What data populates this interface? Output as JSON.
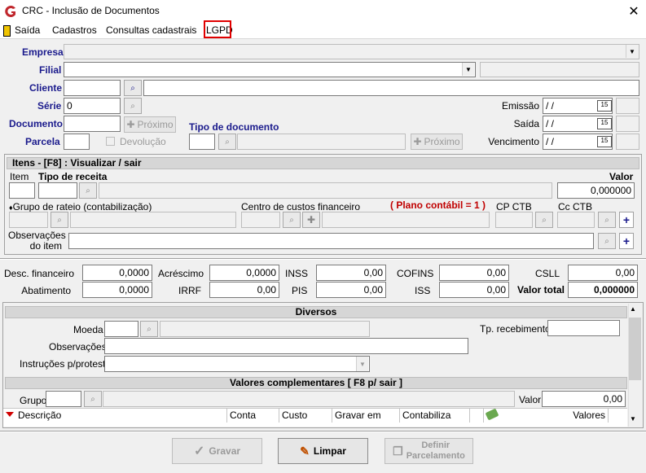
{
  "window": {
    "title": "CRC - Inclusão de Documentos",
    "close": "✕"
  },
  "menu": {
    "saida": "Saída",
    "cadastros": "Cadastros",
    "consultas": "Consultas cadastrais",
    "lgpd": "LGPD"
  },
  "header": {
    "empresa": "Empresa",
    "filial": "Filial",
    "cliente": "Cliente",
    "serie": "Série",
    "serie_value": "0",
    "documento": "Documento",
    "parcela": "Parcela",
    "proximo": "Próximo",
    "devolucao": "Devolução",
    "tipo_documento": "Tipo de documento",
    "proximo2": "Próximo",
    "emissao": "Emissão",
    "saida": "Saída",
    "vencimento": "Vencimento",
    "date_placeholder": " /  /",
    "cal": "15"
  },
  "itens": {
    "title": "Itens   - [F8] : Visualizar / sair",
    "item": "Item",
    "tipo_receita": "Tipo de receita",
    "valor": "Valor",
    "valor_value": "0,000000",
    "grupo_rateio": "Grupo de rateio (contabilização)",
    "centro_custos": "Centro de custos financeiro",
    "plano": "( Plano contábil = 1 )",
    "cp_ctb": "CP CTB",
    "cc_ctb": "Cc CTB",
    "obs_line1": "Observações",
    "obs_line2": "do item"
  },
  "totais": {
    "desc_fin": "Desc. financeiro",
    "desc_fin_v": "0,0000",
    "acrescimo": "Acréscimo",
    "acrescimo_v": "0,0000",
    "inss": "INSS",
    "inss_v": "0,00",
    "cofins": "COFINS",
    "cofins_v": "0,00",
    "csll": "CSLL",
    "csll_v": "0,00",
    "abatimento": "Abatimento",
    "abatimento_v": "0,0000",
    "irrf": "IRRF",
    "irrf_v": "0,00",
    "pis": "PIS",
    "pis_v": "0,00",
    "iss": "ISS",
    "iss_v": "0,00",
    "valor_total": "Valor total",
    "valor_total_v": "0,000000"
  },
  "diversos": {
    "title": "Diversos",
    "moeda": "Moeda",
    "tp_recebimento": "Tp. recebimento",
    "observacoes": "Observações",
    "instrucoes": "Instruções p/protesto"
  },
  "complementares": {
    "title": "Valores complementares  [ F8 p/ sair ]",
    "grupo": "Grupo",
    "valor": "Valor",
    "valor_v": "0,00",
    "columns": [
      "Descrição",
      "Conta",
      "Custo",
      "Gravar em",
      "Contabiliza",
      "",
      "Valores"
    ]
  },
  "buttons": {
    "gravar": "Gravar",
    "limpar": "Limpar",
    "definir1": "Definir",
    "definir2": "Parcelamento"
  }
}
